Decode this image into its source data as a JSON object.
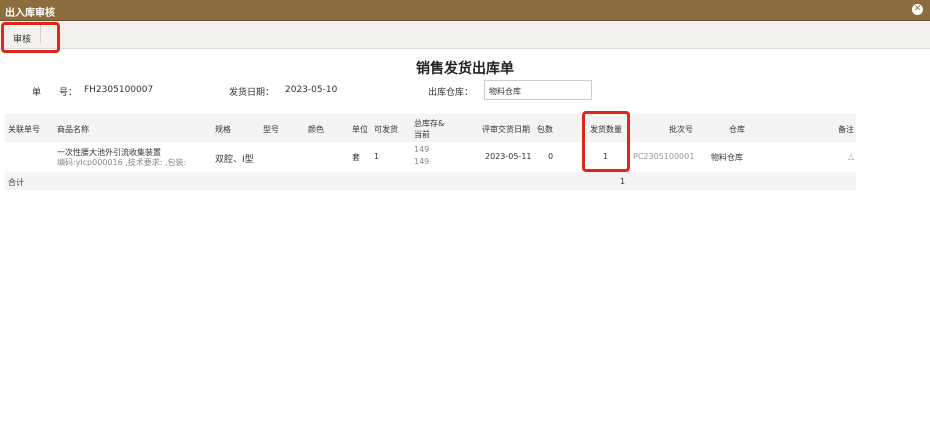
{
  "window": {
    "title": "出入库审核",
    "close_glyph": "✕"
  },
  "toolbar": {
    "approve_label": "审核"
  },
  "document": {
    "title": "销售发货出库单",
    "number_label": "单　　号：",
    "number_value": "FH2305100007",
    "date_label": "发货日期：",
    "date_value": "2023-05-10",
    "warehouse_label": "出库仓库：",
    "warehouse_value": "物料仓库"
  },
  "table": {
    "headers": {
      "link_no": "关联单号",
      "product_name": "商品名称",
      "spec": "规格",
      "model": "型号",
      "color": "颜色",
      "unit": "单位",
      "available": "可发货",
      "stock_line1": "总库存&",
      "stock_line2": "当前",
      "review_date": "评审交货日期",
      "packages": "包数",
      "ship_qty": "发货数量",
      "batch_no": "批次号",
      "warehouse": "仓库",
      "remark": "备注"
    },
    "rows": [
      {
        "product_name": "一次性腰大池外引流收集装置",
        "product_sub": "编码:ylcp000016 ,技术要求: ,包装:",
        "spec": "双腔、I型",
        "unit": "套",
        "available": "1",
        "stock_total": "149",
        "stock_current": "149",
        "review_date": "2023-05-11",
        "packages": "0",
        "ship_qty": "1",
        "batch_no": "PC2305100001",
        "warehouse": "物料仓库",
        "remark_icon": "△"
      }
    ],
    "total_label": "合计",
    "total_qty": "1"
  },
  "colors": {
    "titlebar": "#8d6d40",
    "highlight": "#e0261b",
    "header_bg": "#f5f4f2"
  }
}
